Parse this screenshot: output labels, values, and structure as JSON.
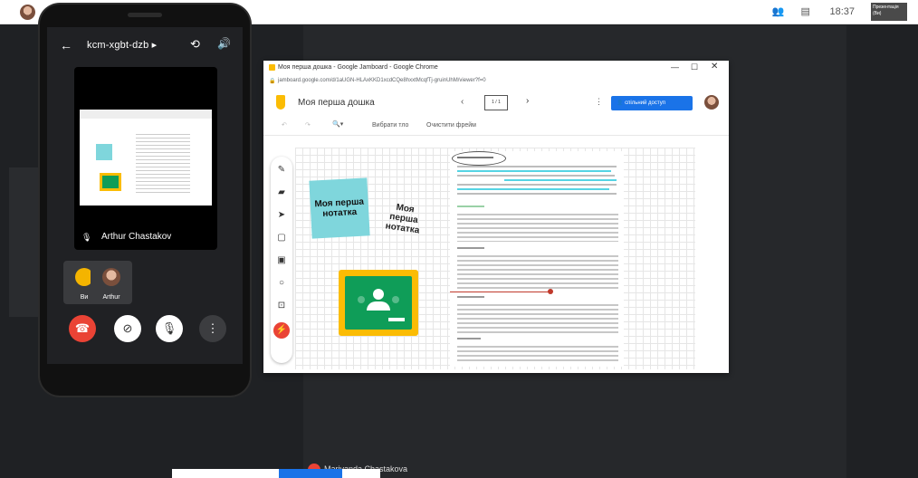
{
  "meet": {
    "meeting_code": "kcm-xgbt-dzb",
    "presenter_name": "Arthur Chastakov",
    "participants": [
      {
        "label": "Ви"
      },
      {
        "label": "Arthur"
      }
    ],
    "bottom_name": "Mariyanda Chastakova"
  },
  "topbar": {
    "time": "18:37",
    "presentation_label": "Презентація (Ви)"
  },
  "chrome": {
    "window_title": "Моя перша дошка - Google Jamboard - Google Chrome",
    "url": "jamboard.google.com/d/1aUGN-HLAxKKD1xcdCQe8hxxtMcqfTj-gruinUhM/viewer?f=0"
  },
  "jamboard": {
    "board_title": "Моя перша дошка",
    "frame_counter": "1 / 1",
    "share_button": "спільний доступ",
    "toolbar": {
      "select_bg": "Вибрати тло",
      "clear_frame": "Очистити фрейм"
    },
    "sticky_note": "Моя перша нотатка",
    "handwritten": "Моя перша нотатка"
  },
  "colors": {
    "end_call": "#ea4335",
    "sticky": "#7fd6dc",
    "classroom_yellow": "#fbbc04",
    "classroom_green": "#0f9d58",
    "share_blue": "#1a73e8"
  }
}
